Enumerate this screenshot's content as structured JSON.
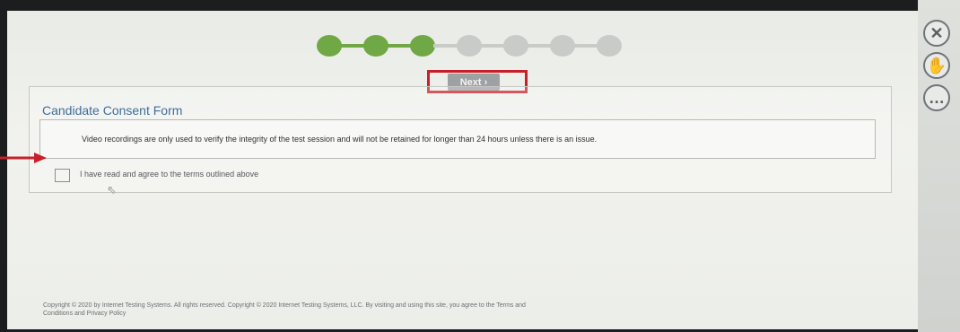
{
  "progress": {
    "steps_total": 7,
    "steps_completed": 3,
    "colors": {
      "done": "#6fa845",
      "todo": "#c9cbc8"
    }
  },
  "navigation": {
    "next_label": "Next ›",
    "highlight_color": "#c8202a"
  },
  "consent": {
    "title": "Candidate Consent Form",
    "notice": "Video recordings are only used to verify the integrity of the test session and will not be retained for longer than 24 hours unless there is an issue.",
    "checkbox_label": "I have read and agree to the terms outlined above",
    "checkbox_checked": false
  },
  "sidebar": {
    "items": [
      {
        "name": "close",
        "icon": "close-icon"
      },
      {
        "name": "raise-hand",
        "icon": "hand-icon"
      },
      {
        "name": "chat",
        "icon": "chat-icon"
      }
    ]
  },
  "footer": {
    "line1": "Copyright © 2020 by Internet Testing Systems. All rights reserved. Copyright © 2020 Internet Testing Systems, LLC. By visiting and using this site, you agree to the Terms and",
    "line2": "Conditions and Privacy Policy"
  }
}
